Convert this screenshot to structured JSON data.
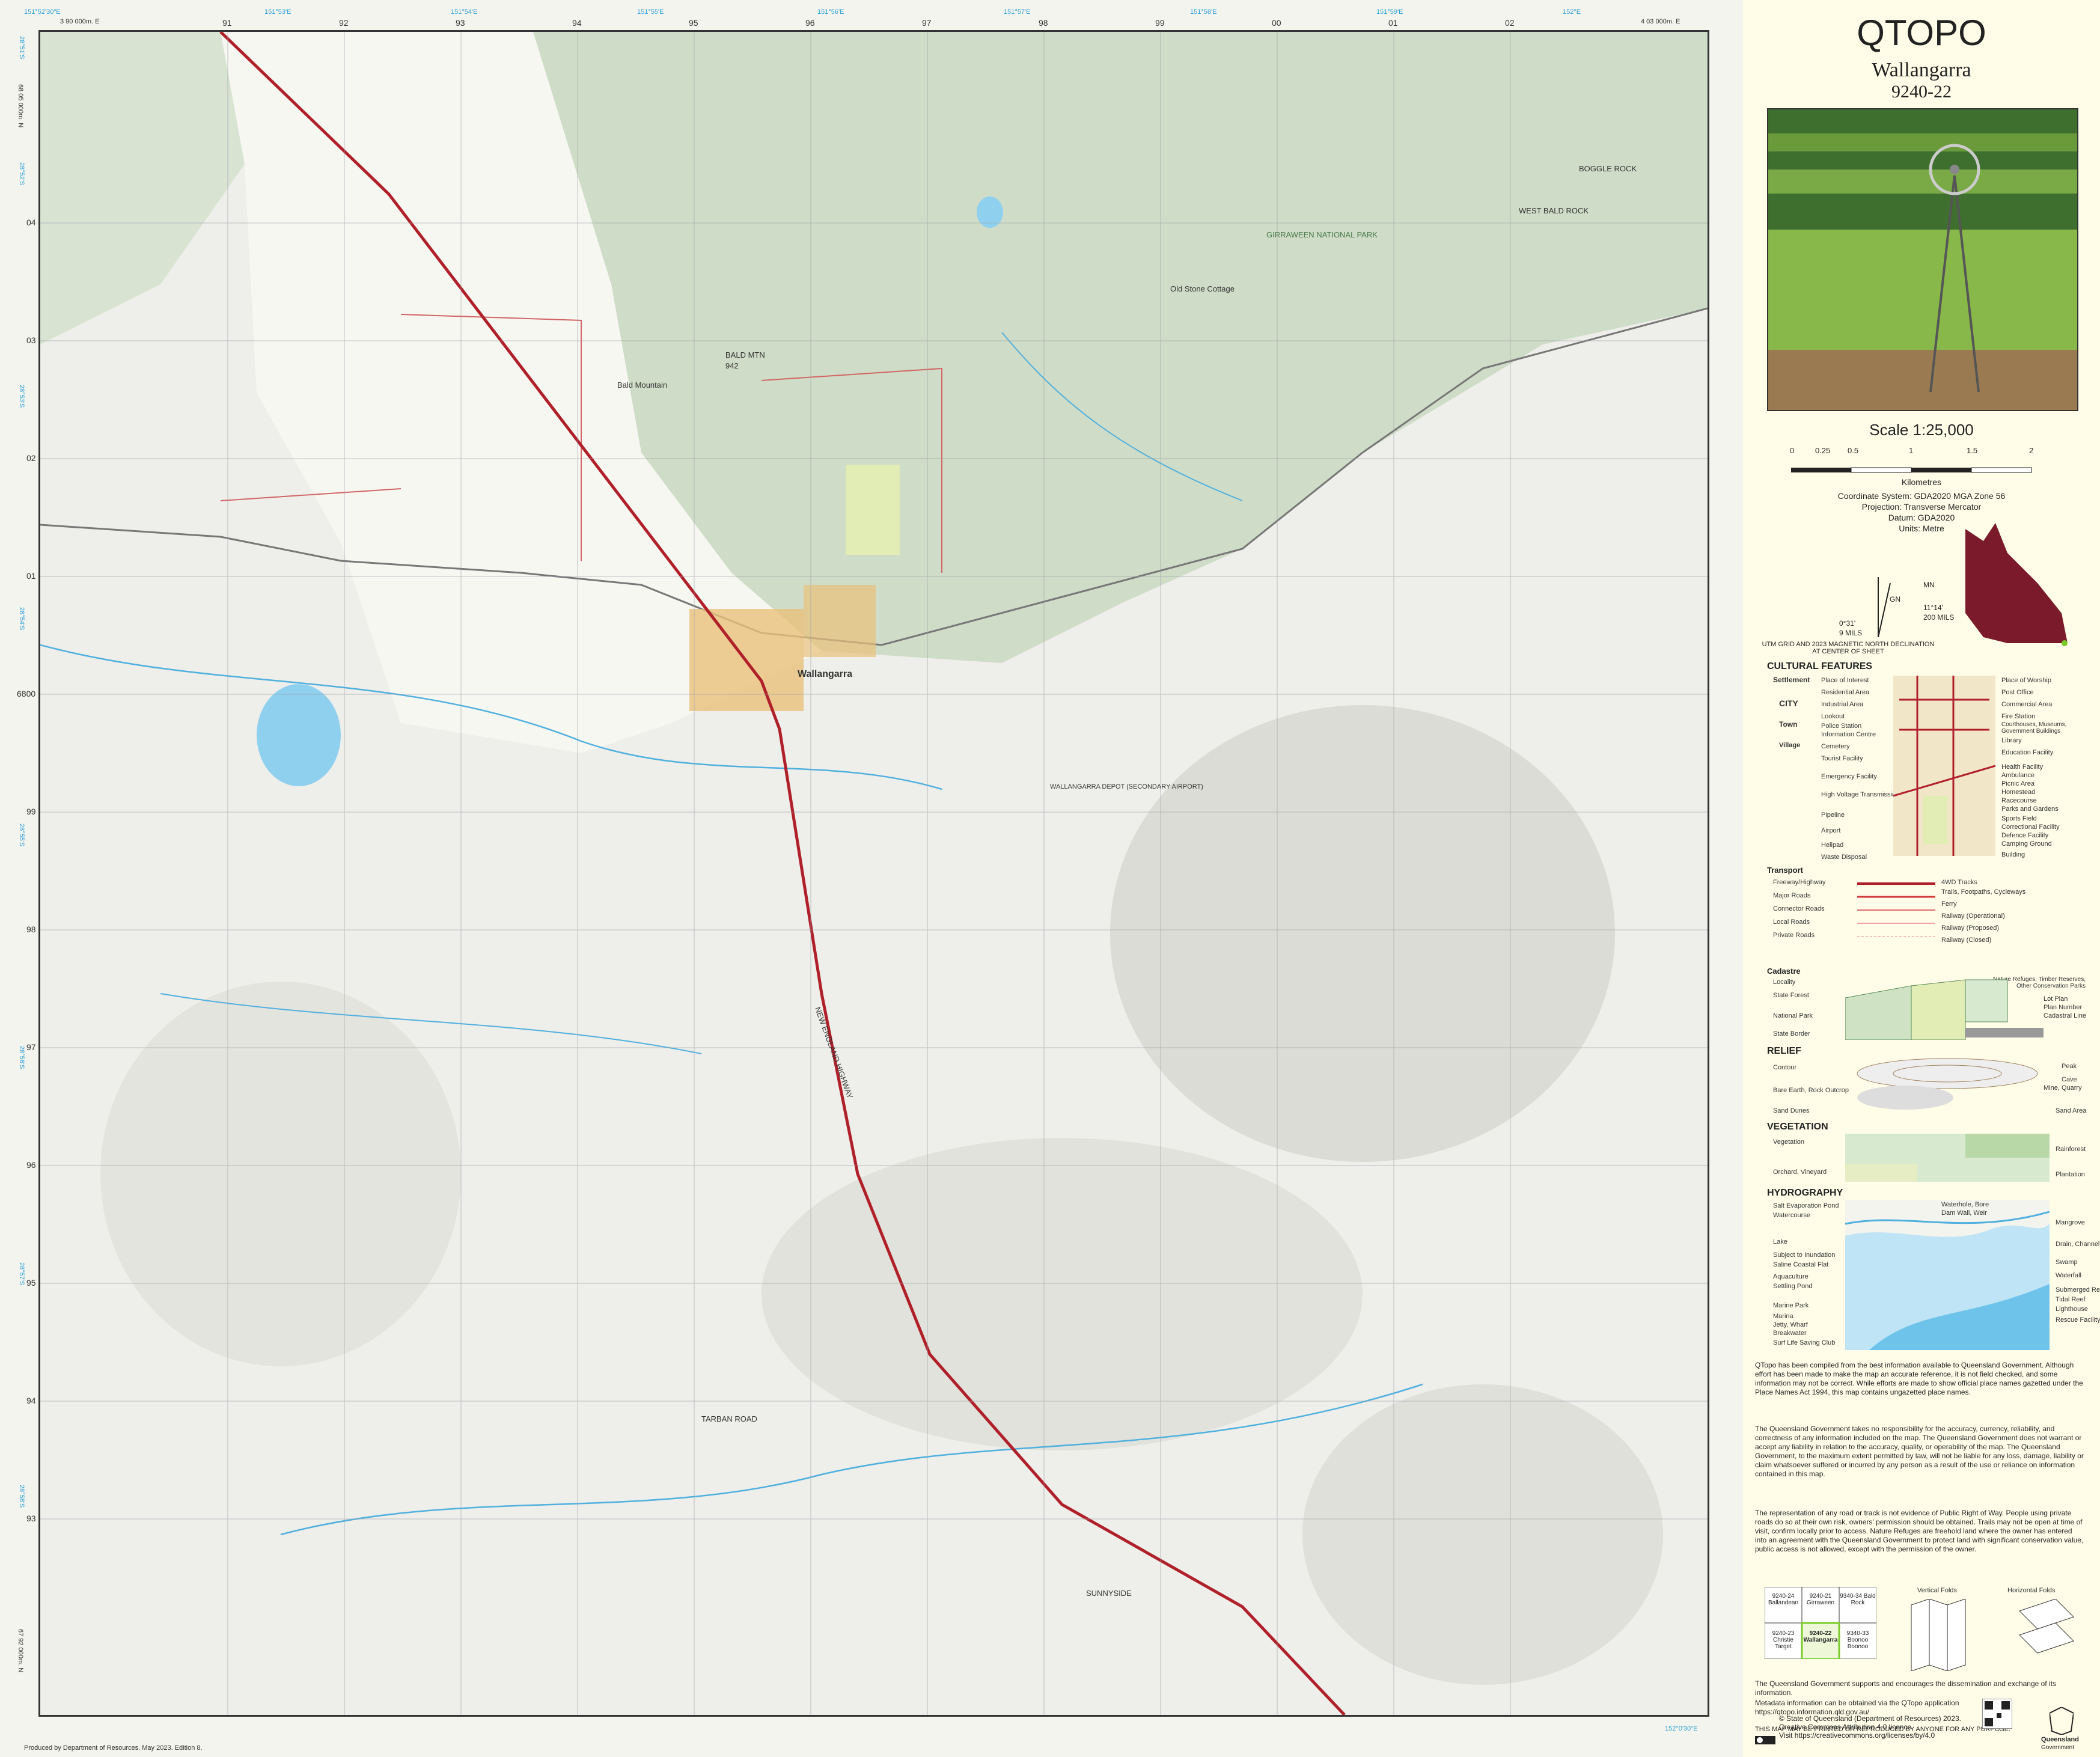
{
  "title": "QTOPO",
  "subtitle": "Wallangarra",
  "sheet_number": "9240-22",
  "scale": {
    "label": "Scale 1:25,000",
    "ticks": [
      "0",
      "0.25",
      "0.5",
      "1",
      "1.5",
      "2"
    ],
    "unit": "Kilometres"
  },
  "coordinate_info": [
    "Coordinate System: GDA2020 MGA Zone 56",
    "Projection: Transverse Mercator",
    "Datum: GDA2020",
    "Units: Metre"
  ],
  "declination": {
    "mn": "MN",
    "gn": "GN",
    "tn_value": "0°31'",
    "tn_mils": "9 MILS",
    "mn_value": "11°14'",
    "mn_mils": "200 MILS",
    "caption": "UTM GRID AND 2023 MAGNETIC NORTH DECLINATION AT CENTER OF SHEET"
  },
  "colors": {
    "map_bg": "#eeeeea",
    "forest": "#cfdcc7",
    "highway": "#b0202a",
    "water": "#4fb0df",
    "town": "#e8c17a",
    "grid": "#9aa0a6",
    "sidebar_bg": "#fffde8",
    "qld_map": "#7a1a2a"
  },
  "map": {
    "grid_top_labels": [
      "91",
      "92",
      "93",
      "94",
      "95",
      "96",
      "97",
      "98",
      "99",
      "00",
      "01",
      "02"
    ],
    "grid_top_corner_left": "3 90 000m. E",
    "grid_top_corner_right": "4 03 000m. E",
    "grid_left_labels": [
      "04",
      "03",
      "02",
      "01",
      "00",
      "99",
      "98",
      "97",
      "96",
      "95",
      "94",
      "93"
    ],
    "grid_left_corner_top": "68 05 000m. N",
    "grid_left_corner_bottom": "67 92 000m. N",
    "grid_left_mid": "6800",
    "cyan_top_labels": [
      "151°52'30\"E",
      "151°53'E",
      "151°54'E",
      "151°55'E",
      "151°56'E",
      "151°57'E",
      "151°58'E",
      "151°59'E",
      "152°E",
      "152°0'30\"E"
    ],
    "cyan_left_labels": [
      "28°51'S",
      "28°52'S",
      "28°53'S",
      "28°54'S",
      "28°55'S",
      "28°56'S",
      "28°57'S",
      "28°58'S"
    ],
    "places": {
      "town": "Wallangarra",
      "bald_mtn": "BALD MTN",
      "bald_mtn_elev": "942",
      "bald_mountain": "Bald Mountain",
      "girraween": "GIRRAWEEN NATIONAL PARK",
      "bald_rock": "BOGGLE ROCK",
      "west_bald_rock": "WEST BALD ROCK",
      "old_stone_cottage": "Old Stone Cottage",
      "highway_label": "NEW ENGLAND HIGHWAY",
      "tarban_road": "TARBAN ROAD",
      "sunnyside": "SUNNYSIDE",
      "defence": "WALLANGARRA DEPOT (SECONDARY AIRPORT)"
    },
    "credit": "Produced by Department of Resources. May 2023. Edition 8."
  },
  "legend": {
    "cultural_header": "CULTURAL FEATURES",
    "settlement": "Settlement",
    "city": "CITY",
    "town": "Town",
    "village": "Village",
    "left_items": [
      "Place of Interest",
      "Residential Area",
      "Industrial Area",
      "Lookout",
      "Police Station",
      "Information Centre",
      "Cemetery",
      "Tourist Facility",
      "Emergency Facility",
      "High Voltage Transmission",
      "Pipeline",
      "Airport",
      "Helipad",
      "Waste Disposal"
    ],
    "right_items": [
      "Place of Worship",
      "Post Office",
      "Commercial Area",
      "Fire Station",
      "Courthouses, Museums, Government Buildings",
      "Library",
      "Education Facility",
      "Health Facility",
      "Ambulance",
      "Picnic Area",
      "Homestead",
      "Racecourse",
      "Parks and Gardens",
      "Sports Field",
      "Correctional Facility",
      "Defence Facility",
      "Camping Ground",
      "Building"
    ],
    "transport_header": "Transport",
    "transport_items": [
      "Freeway/Highway",
      "Major Roads",
      "Connector Roads",
      "Local Roads",
      "Private Roads"
    ],
    "transport_right": [
      "4WD Tracks",
      "Trails, Footpaths, Cycleways",
      "Ferry",
      "Railway (Operational)",
      "Railway (Proposed)",
      "Railway (Closed)"
    ],
    "cadastre_header": "Cadastre",
    "cadastre_items": [
      "Locality",
      "State Forest",
      "National Park",
      "State Border"
    ],
    "cadastre_right": [
      "Nature Refuges, Timber Reserves, Other Conservation Parks",
      "Lot Plan",
      "Plan Number",
      "Cadastral Line"
    ],
    "relief_header": "RELIEF",
    "relief_items": [
      "Contour",
      "Bare Earth, Rock Outcrop",
      "Sand Dunes"
    ],
    "relief_right": [
      "Peak",
      "Cave",
      "Mine, Quarry",
      "Sand Area"
    ],
    "vegetation_header": "VEGETATION",
    "vegetation_items": [
      "Vegetation",
      "Orchard, Vineyard"
    ],
    "vegetation_right": [
      "Rainforest",
      "Plantation"
    ],
    "hydrography_header": "HYDROGRAPHY",
    "hydro_items": [
      "Salt Evaporation Pond",
      "Watercourse",
      "Lake",
      "Subject to Inundation",
      "Saline Coastal Flat",
      "Aquaculture",
      "Settling Pond",
      "Marine Park",
      "Marina",
      "Jetty, Wharf",
      "Breakwater",
      "Surf Life Saving Club"
    ],
    "hydro_right": [
      "Waterhole, Bore",
      "Dam Wall, Weir",
      "Mangrove",
      "Drain, Channel",
      "Swamp",
      "Waterfall",
      "Submerged Reef",
      "Tidal Reef",
      "Lighthouse",
      "Rescue Facility"
    ]
  },
  "disclaimer": [
    "QTopo has been compiled from the best information available to Queensland Government. Although effort has been made to make the map an accurate reference, it is not field checked, and some information may not be correct. While efforts are made to show official place names gazetted under the Place Names Act 1994, this map contains ungazetted place names.",
    "The Queensland Government takes no responsibility for the accuracy, currency, reliability, and correctness of any information included on the map. The Queensland Government does not warrant or accept any liability in relation to the accuracy, quality, or operability of the map. The Queensland Government, to the maximum extent permitted by law, will not be liable for any loss, damage, liability or claim whatsoever suffered or incurred by any person as a result of the use or reliance on information contained in this map.",
    "The representation of any road or track is not evidence of Public Right of Way. People using private roads do so at their own risk, owners' permission should be obtained. Trails may not be open at time of visit, confirm locally prior to access. Nature Refuges are freehold land where the owner has entered into an agreement with the Queensland Government to protect land with significant conservation value, public access is not allowed, except with the permission of the owner."
  ],
  "index_grid": [
    [
      "9240-24 Ballandean",
      "9240-21 Girraween",
      "9340-34 Bald Rock"
    ],
    [
      "9240-23 Christie Target",
      "9240-22 Wallangarra",
      "9340-33 Boonoo Boonoo"
    ]
  ],
  "folds": {
    "vertical": "Vertical Folds",
    "horizontal": "Horizontal Folds"
  },
  "footer": [
    "The Queensland Government supports and encourages the dissemination and exchange of its information.",
    "Metadata information can be obtained via the QTopo application https://qtopo.information.qld.gov.au/",
    "THIS MAP MAY BE PRINTED OR REPRODUCED BY ANYONE FOR ANY PURPOSE."
  ],
  "copyright": [
    "© State of Queensland (Department of Resources) 2023.",
    "Creative Commons Attribution 4.0 licence.",
    "Visit https://creativecommons.org/licenses/by/4.0"
  ],
  "govt": [
    "Queensland",
    "Government"
  ]
}
